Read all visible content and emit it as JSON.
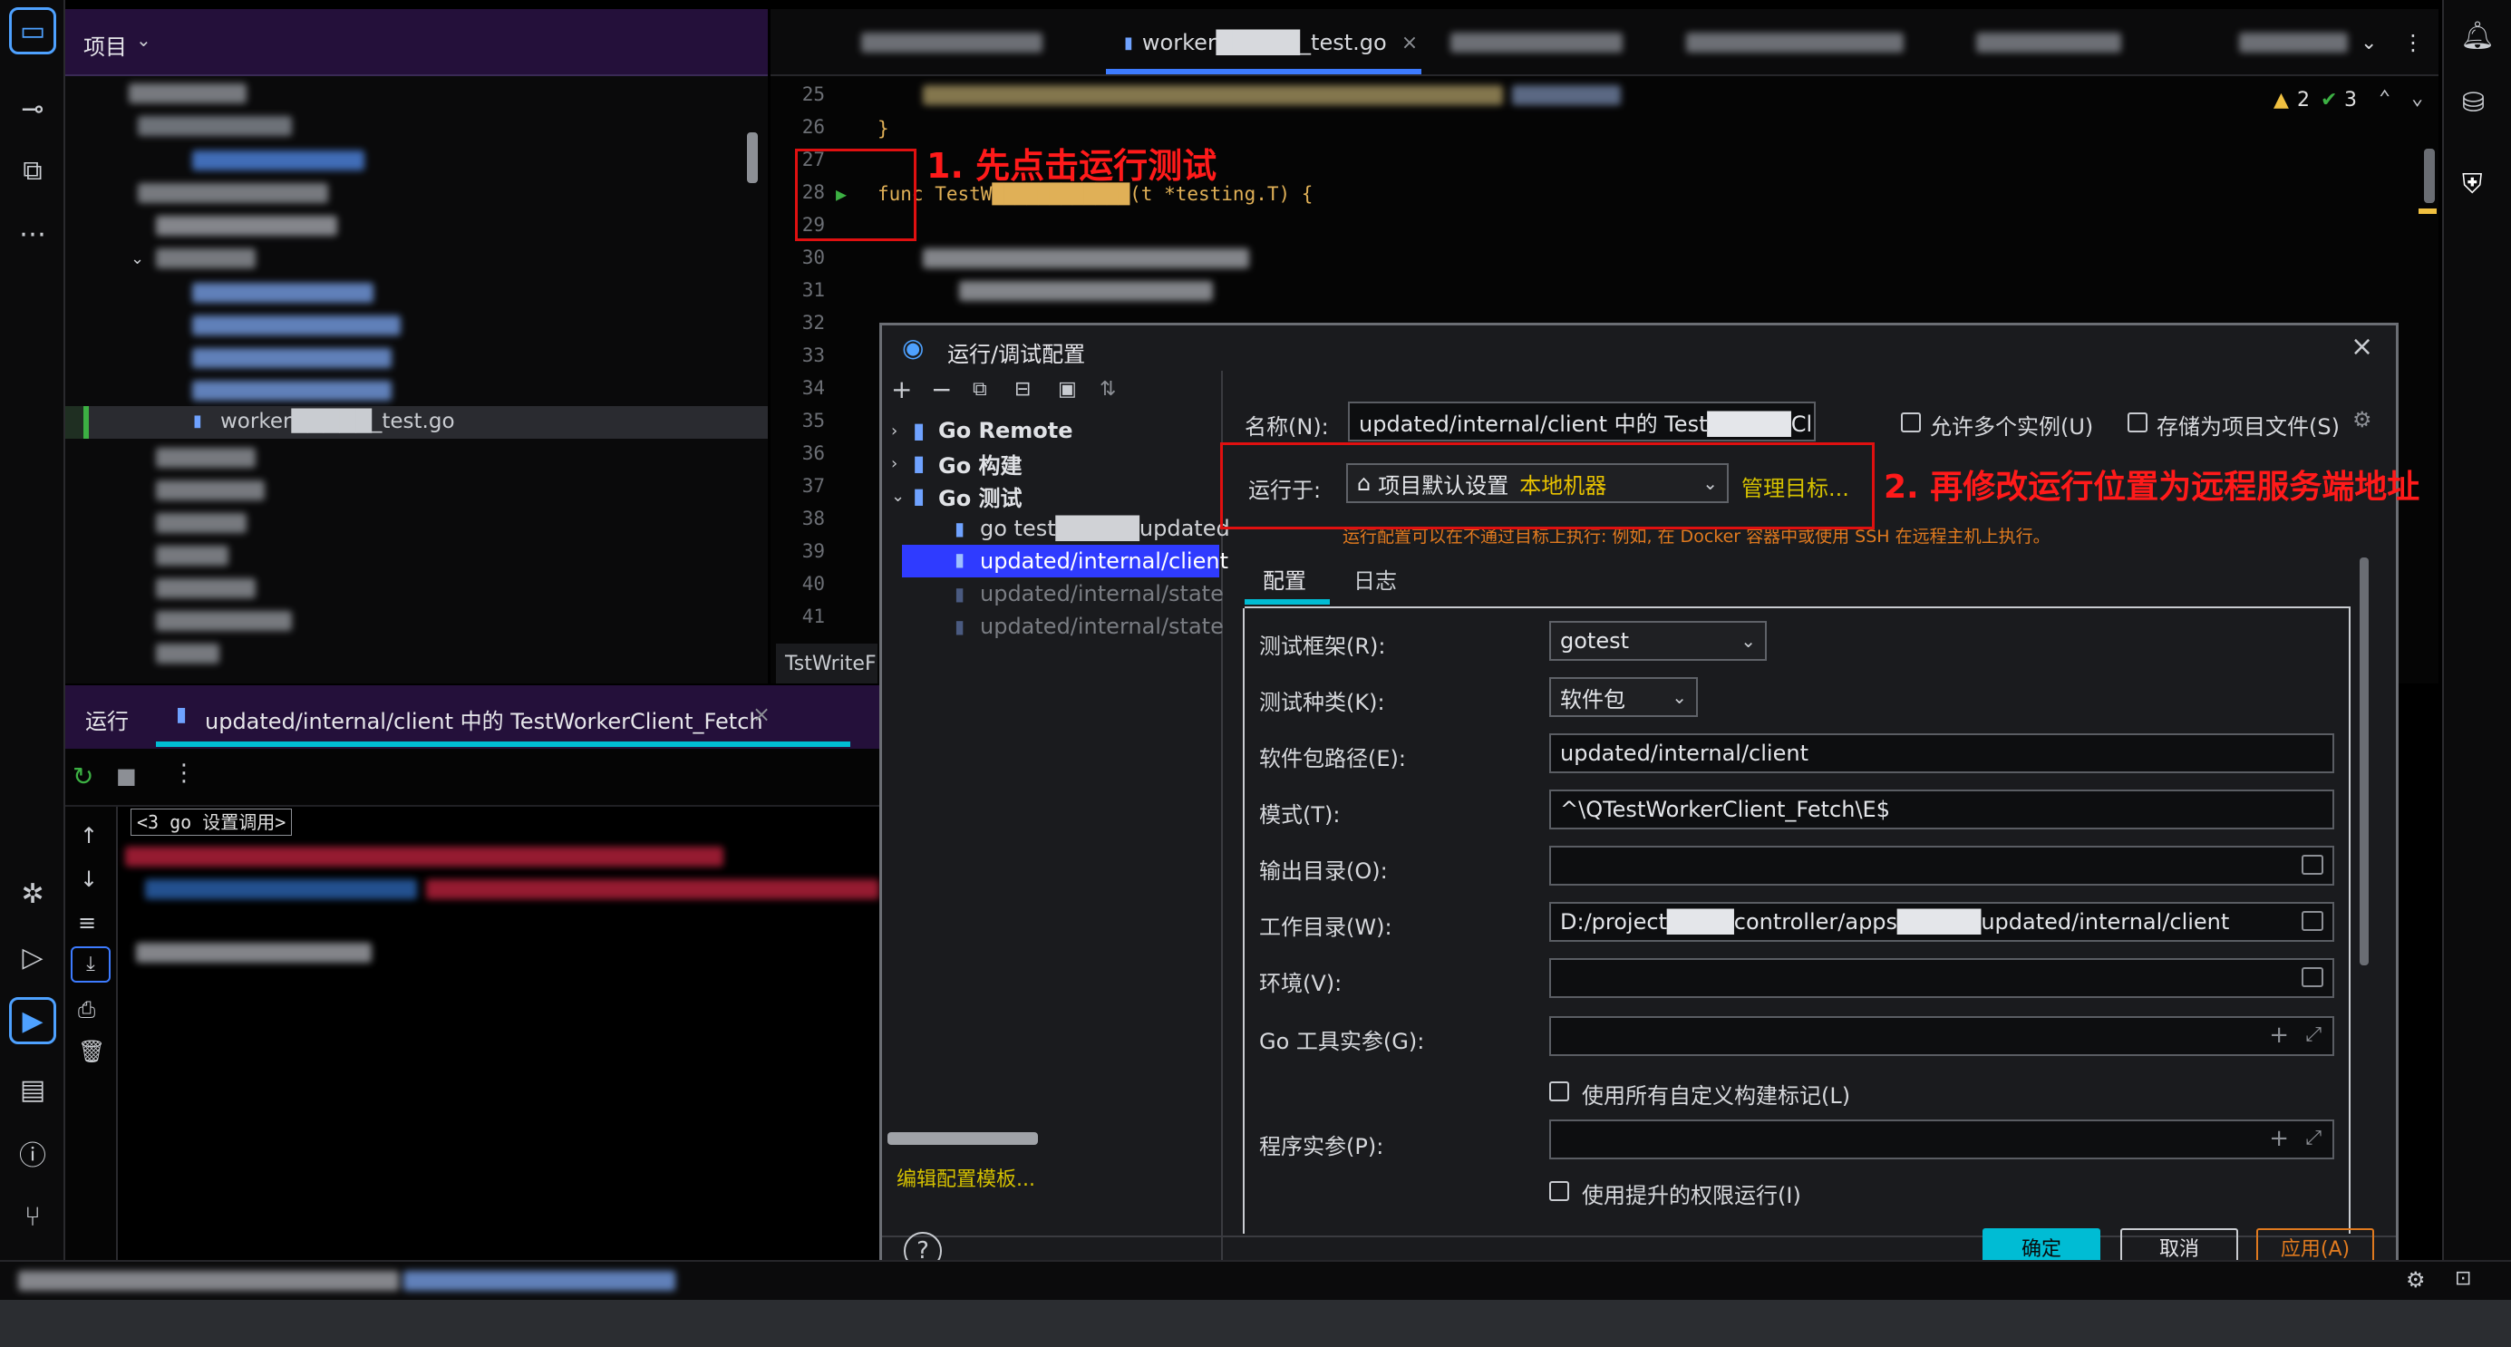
{
  "project": {
    "title": "项目",
    "selected_file": "worker█████_test.go"
  },
  "editor": {
    "active_tab": "worker█████_test.go",
    "line_numbers": [
      "25",
      "26",
      "27",
      "28",
      "29",
      "30",
      "31",
      "32",
      "33",
      "34",
      "35",
      "36",
      "37",
      "38",
      "39",
      "40",
      "41"
    ],
    "code_line_26": "}",
    "code_line_28": "func TestW████████████(t *testing.T) {",
    "inspection_warnings": "2",
    "inspection_ok": "3",
    "side_label": "TstWriteF"
  },
  "annotations": {
    "step1": "1. 先点击运行测试",
    "step2": "2. 再修改运行位置为远程服务端地址"
  },
  "run_panel": {
    "title": "运行",
    "tab_label": "updated/internal/client 中的 TestWorkerClient_Fetch",
    "console_line1": "<3 go 设置调用>"
  },
  "dialog": {
    "title": "运行/调试配置",
    "tree": {
      "groups": [
        {
          "label": "Go Remote",
          "expanded": false
        },
        {
          "label": "Go 构建",
          "expanded": false
        },
        {
          "label": "Go 测试",
          "expanded": true
        }
      ],
      "children": [
        {
          "label": "go test█████updated",
          "selected": false
        },
        {
          "label": "updated/internal/client",
          "selected": true
        },
        {
          "label": "updated/internal/state",
          "selected": false
        },
        {
          "label": "updated/internal/state",
          "selected": false
        }
      ],
      "edit_templates_link": "编辑配置模板..."
    },
    "name_label": "名称(N):",
    "name_value": "updated/internal/client 中的 Test█████Client_F",
    "allow_parallel_label": "允许多个实例(U)",
    "store_as_file_label": "存储为项目文件(S)",
    "run_on_label": "运行于:",
    "run_on_value": "项目默认设置",
    "run_on_value_hint": "本地机器",
    "manage_targets_link": "管理目标...",
    "run_on_hint": "运行配置可以在不通过目标上执行: 例如, 在 Docker 容器中或使用 SSH 在远程主机上执行。",
    "tabs": [
      "配置",
      "日志"
    ],
    "fields": {
      "test_framework_label": "测试框架(R):",
      "test_framework_value": "gotest",
      "test_kind_label": "测试种类(K):",
      "test_kind_value": "软件包",
      "package_path_label": "软件包路径(E):",
      "package_path_value": "updated/internal/client",
      "pattern_label": "模式(T):",
      "pattern_value": "^\\QTestWorkerClient_Fetch\\E$",
      "output_dir_label": "输出目录(O):",
      "output_dir_value": "",
      "working_dir_label": "工作目录(W):",
      "working_dir_value": "D:/project████controller/apps█████updated/internal/client",
      "env_label": "环境(V):",
      "env_value": "",
      "go_tool_args_label": "Go 工具实参(G):",
      "go_tool_args_value": "",
      "use_custom_tags_label": "使用所有自定义构建标记(L)",
      "program_args_label": "程序实参(P):",
      "program_args_value": "",
      "sudo_label": "使用提升的权限运行(I)"
    },
    "buttons": {
      "ok": "确定",
      "cancel": "取消",
      "apply": "应用(A)"
    }
  },
  "colors": {
    "accent": "#3d7bff",
    "annotation_red": "#ff1a1a",
    "ok_button": "#00bcd4",
    "apply_border": "#e07a1f",
    "selection": "#2f3bff"
  }
}
